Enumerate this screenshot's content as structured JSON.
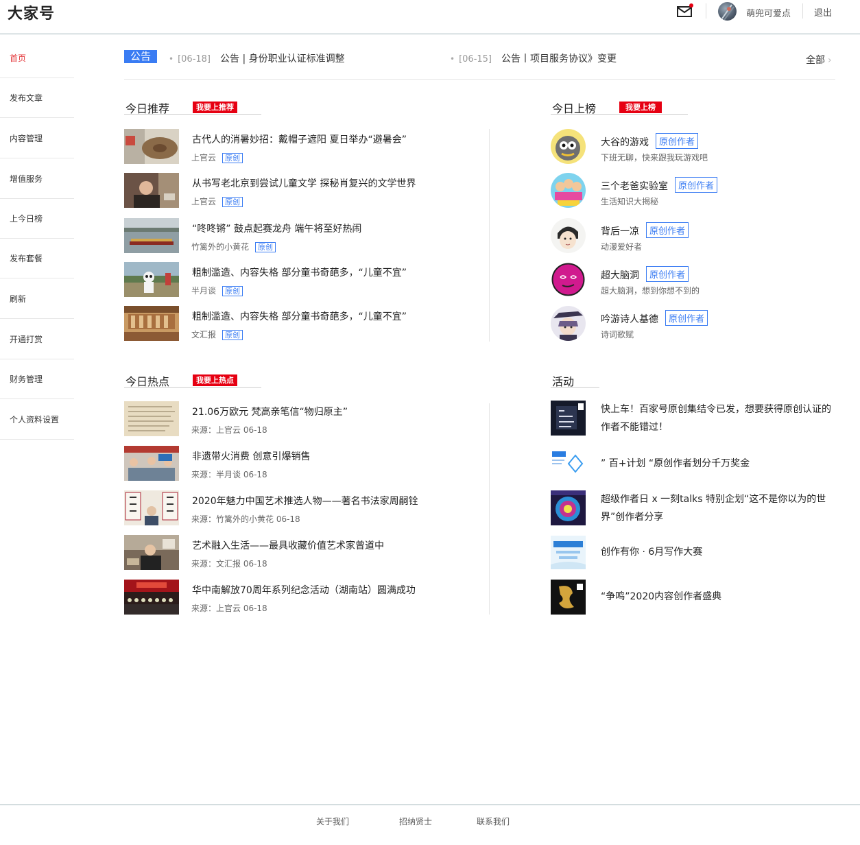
{
  "header": {
    "logo": "大家号",
    "username": "萌兜可爱点",
    "logout": "退出"
  },
  "sidebar": {
    "items": [
      {
        "label": "首页"
      },
      {
        "label": "发布文章"
      },
      {
        "label": "内容管理"
      },
      {
        "label": "增值服务"
      },
      {
        "label": "上今日榜"
      },
      {
        "label": "发布套餐"
      },
      {
        "label": "刷新"
      },
      {
        "label": "开通打赏"
      },
      {
        "label": "财务管理"
      },
      {
        "label": "个人资料设置"
      }
    ]
  },
  "notice": {
    "badge": "公告",
    "items": [
      {
        "date": "[06-18]",
        "text": "公告 | 身份职业认证标准调整"
      },
      {
        "date": "[06-15]",
        "text": "公告丨项目服务协议》变更"
      }
    ],
    "all": "全部"
  },
  "recommend": {
    "title": "今日推荐",
    "button": "我要上推荐",
    "items": [
      {
        "title": "古代人的消暑妙招：戴帽子遮阳 夏日举办“避暑会”",
        "source": "上官云",
        "tag": "原创"
      },
      {
        "title": "从书写老北京到尝试儿童文学 探秘肖复兴的文学世界",
        "source": "上官云",
        "tag": "原创"
      },
      {
        "title": "“咚咚锵” 鼓点起赛龙舟 端午将至好热闹",
        "source": "竹篱外的小黄花",
        "tag": "原创"
      },
      {
        "title": "粗制滥造、内容失格 部分童书奇葩多，“儿童不宜”",
        "source": "半月谈",
        "tag": "原创"
      },
      {
        "title": "粗制滥造、内容失格 部分童书奇葩多，“儿童不宜”",
        "source": "文汇报",
        "tag": "原创"
      }
    ]
  },
  "ranking": {
    "title": "今日上榜",
    "button": "我要上榜",
    "items": [
      {
        "name": "大谷的游戏",
        "tag": "原创作者",
        "desc": "下班无聊，快来跟我玩游戏吧"
      },
      {
        "name": "三个老爸实验室",
        "tag": "原创作者",
        "desc": "生活知识大揭秘"
      },
      {
        "name": "背后一凉",
        "tag": "原创作者",
        "desc": "动漫爱好者"
      },
      {
        "name": "超大脑洞",
        "tag": "原创作者",
        "desc": "超大脑洞，想到你想不到的"
      },
      {
        "name": "吟游诗人基德",
        "tag": "原创作者",
        "desc": "诗词歌赋"
      }
    ]
  },
  "hot": {
    "title": "今日热点",
    "button": "我要上热点",
    "items": [
      {
        "title": "21.06万欧元 梵高亲笔信“物归原主”",
        "meta": "来源：上官云   06-18"
      },
      {
        "title": "非遗带火消费 创意引爆销售",
        "meta": "来源：半月谈   06-18"
      },
      {
        "title": "2020年魅力中国艺术推选人物——著名书法家周嗣铨",
        "meta": "来源：竹篱外的小黄花   06-18"
      },
      {
        "title": "艺术融入生活——最具收藏价值艺术家曾道中",
        "meta": "来源：文汇报   06-18"
      },
      {
        "title": "华中南解放70周年系列纪念活动（湖南站）圆满成功",
        "meta": "来源：上官云   06-18"
      }
    ]
  },
  "activity": {
    "title": "活动",
    "items": [
      {
        "title": "快上车！百家号原创集结令已发，想要获得原创认证的作者不能错过！"
      },
      {
        "title": "” 百+计划 “原创作者划分千万奖金"
      },
      {
        "title": "超级作者日 x 一刻talks 特别企划“这不是你以为的世界”创作者分享"
      },
      {
        "title": "创作有你 · 6月写作大赛"
      },
      {
        "title": "“争鸣”2020内容创作者盛典"
      }
    ]
  },
  "footer": {
    "links": [
      "关于我们",
      "招纳贤士",
      "联系我们"
    ]
  },
  "colors": {
    "accent_red": "#e60012",
    "active_red": "#e4393c",
    "link_blue": "#3a7cf3"
  }
}
